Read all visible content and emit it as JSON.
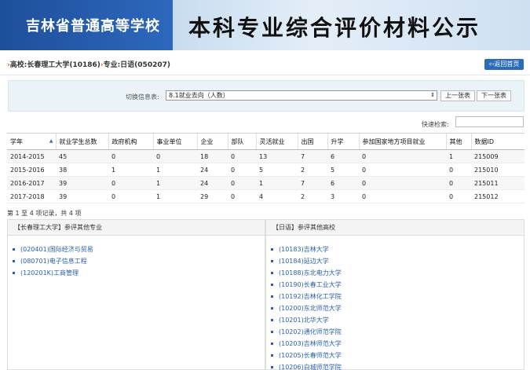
{
  "banner": {
    "school": "吉林省普通高等学校",
    "publication": "本科专业综合评价材料公示"
  },
  "breadcrumb": {
    "arrow": "›",
    "school": "高校:长春理工大学(10186)",
    "major": "专业:日语(050207)"
  },
  "back_button": "⇦返回首页",
  "switcher": {
    "label": "切换信息表:",
    "selected": "8.1就业去向（人数）",
    "prev": "上一张表",
    "next": "下一张表"
  },
  "search": {
    "label": "快速检索:",
    "value": ""
  },
  "table": {
    "headers": [
      "学年",
      "就业学生总数",
      "政府机构",
      "事业单位",
      "企业",
      "部队",
      "灵活就业",
      "出国",
      "升学",
      "参加国家地方项目就业",
      "其他",
      "数据ID"
    ],
    "rows": [
      [
        "2014-2015",
        "45",
        "0",
        "0",
        "18",
        "0",
        "13",
        "7",
        "6",
        "0",
        "1",
        "215009"
      ],
      [
        "2015-2016",
        "38",
        "1",
        "1",
        "24",
        "0",
        "5",
        "2",
        "5",
        "0",
        "0",
        "215010"
      ],
      [
        "2016-2017",
        "39",
        "0",
        "1",
        "24",
        "0",
        "1",
        "7",
        "6",
        "0",
        "0",
        "215011"
      ],
      [
        "2017-2018",
        "39",
        "0",
        "1",
        "29",
        "0",
        "4",
        "2",
        "3",
        "0",
        "0",
        "215012"
      ]
    ]
  },
  "summary": "第 1 至 4 项记录，共 4 项",
  "left_box": {
    "title": "【长春理工大学】参评其他专业",
    "items": [
      "(020401)国际经济与贸易",
      "(080701)电子信息工程",
      "(120201K)工商管理"
    ]
  },
  "right_box": {
    "title": "【日语】参评其他高校",
    "items": [
      "(10183)吉林大学",
      "(10184)延边大学",
      "(10188)东北电力大学",
      "(10190)长春工业大学",
      "(10192)吉林化工学院",
      "(10200)东北师范大学",
      "(10201)北华大学",
      "(10202)通化师范学院",
      "(10203)吉林师范大学",
      "(10205)长春师范大学",
      "(10206)白城师范学院"
    ]
  }
}
